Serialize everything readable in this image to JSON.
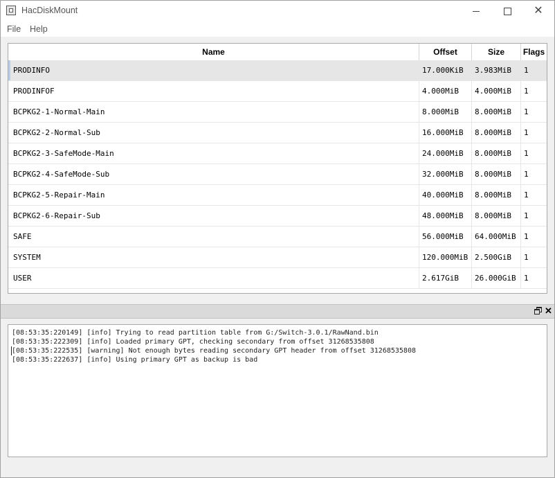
{
  "window": {
    "title": "HacDiskMount",
    "controls": {
      "minimize": "minimize-icon",
      "maximize": "maximize-icon",
      "close": "close-icon"
    }
  },
  "menu": [
    "File",
    "Help"
  ],
  "table": {
    "headers": {
      "name": "Name",
      "offset": "Offset",
      "size": "Size",
      "flags": "Flags"
    },
    "rows": [
      {
        "name": "PRODINFO",
        "offset": "17.000KiB",
        "size": "3.983MiB",
        "flags": "1"
      },
      {
        "name": "PRODINFOF",
        "offset": "4.000MiB",
        "size": "4.000MiB",
        "flags": "1"
      },
      {
        "name": "BCPKG2-1-Normal-Main",
        "offset": "8.000MiB",
        "size": "8.000MiB",
        "flags": "1"
      },
      {
        "name": "BCPKG2-2-Normal-Sub",
        "offset": "16.000MiB",
        "size": "8.000MiB",
        "flags": "1"
      },
      {
        "name": "BCPKG2-3-SafeMode-Main",
        "offset": "24.000MiB",
        "size": "8.000MiB",
        "flags": "1"
      },
      {
        "name": "BCPKG2-4-SafeMode-Sub",
        "offset": "32.000MiB",
        "size": "8.000MiB",
        "flags": "1"
      },
      {
        "name": "BCPKG2-5-Repair-Main",
        "offset": "40.000MiB",
        "size": "8.000MiB",
        "flags": "1"
      },
      {
        "name": "BCPKG2-6-Repair-Sub",
        "offset": "48.000MiB",
        "size": "8.000MiB",
        "flags": "1"
      },
      {
        "name": "SAFE",
        "offset": "56.000MiB",
        "size": "64.000MiB",
        "flags": "1"
      },
      {
        "name": "SYSTEM",
        "offset": "120.000MiB",
        "size": "2.500GiB",
        "flags": "1"
      },
      {
        "name": "USER",
        "offset": "2.617GiB",
        "size": "26.000GiB",
        "flags": "1"
      }
    ]
  },
  "log": {
    "dock_icons": {
      "float": "float-window-icon",
      "close": "close-icon"
    },
    "lines": [
      "[08:53:35:220149] [info] Trying to read partition table from G:/Switch-3.0.1/RawNand.bin",
      "[08:53:35:222309] [info] Loaded primary GPT, checking secondary from offset 31268535808",
      "[08:53:35:222535] [warning] Not enough bytes reading secondary GPT header from offset 31268535808",
      "[08:53:35:222637] [info] Using primary GPT as backup is bad"
    ]
  }
}
